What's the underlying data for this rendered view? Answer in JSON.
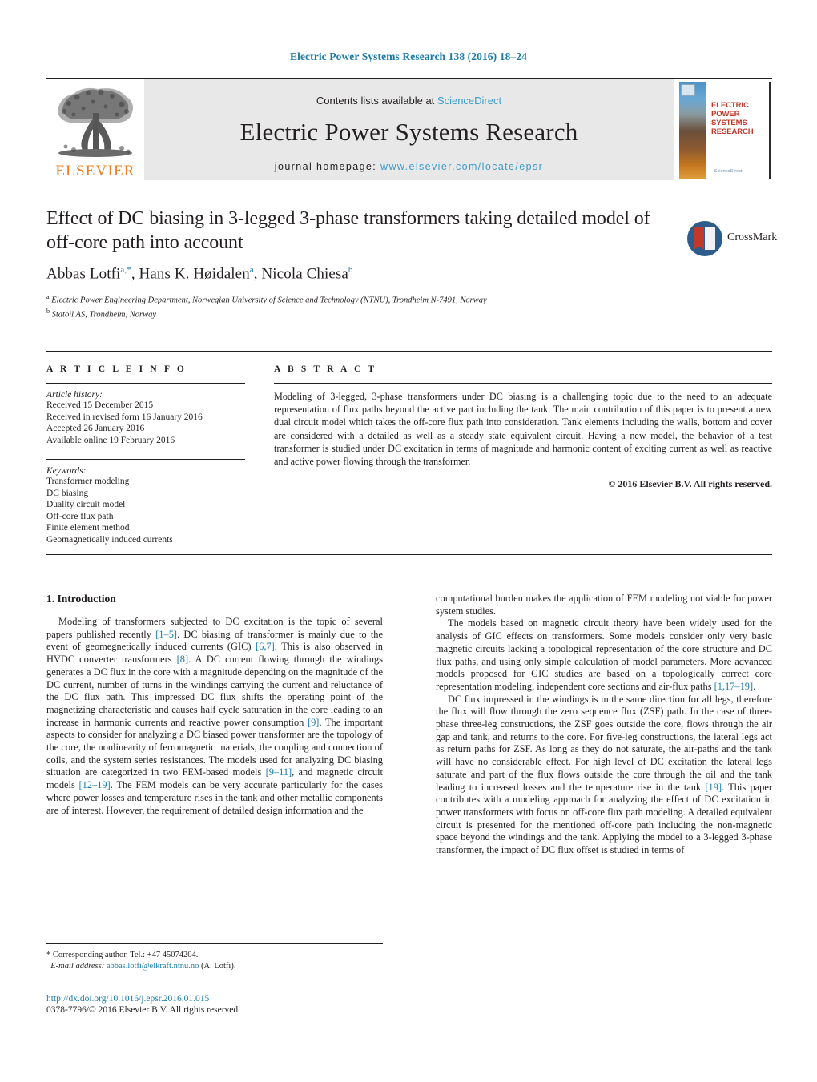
{
  "running_head": "Electric Power Systems Research 138 (2016) 18–24",
  "masthead": {
    "publisher_name": "ELSEVIER",
    "contents_prefix": "Contents lists available at ",
    "contents_link": "ScienceDirect",
    "journal_name": "Electric Power Systems Research",
    "homepage_prefix": "journal homepage: ",
    "homepage_url": "www.elsevier.com/locate/epsr",
    "cover_title": "ELECTRIC POWER SYSTEMS RESEARCH",
    "cover_footer": "ScienceDirect"
  },
  "article": {
    "title": "Effect of DC biasing in 3-legged 3-phase transformers taking detailed model of off-core path into account",
    "crossmark_label": "CrossMark",
    "authors": [
      {
        "name": "Abbas Lotfi",
        "marks": "a,*"
      },
      {
        "name": "Hans K. Høidalen",
        "marks": "a"
      },
      {
        "name": "Nicola Chiesa",
        "marks": "b"
      }
    ],
    "affiliations": [
      {
        "mark": "a",
        "text": "Electric Power Engineering Department, Norwegian University of Science and Technology (NTNU), Trondheim N-7491, Norway"
      },
      {
        "mark": "b",
        "text": "Statoil AS, Trondheim, Norway"
      }
    ]
  },
  "article_info": {
    "heading": "A R T I C L E   I N F O",
    "history_label": "Article history:",
    "history": [
      "Received 15 December 2015",
      "Received in revised form 16 January 2016",
      "Accepted 26 January 2016",
      "Available online 19 February 2016"
    ],
    "keywords_label": "Keywords:",
    "keywords": [
      "Transformer modeling",
      "DC biasing",
      "Duality circuit model",
      "Off-core flux path",
      "Finite element method",
      "Geomagnetically induced currents"
    ]
  },
  "abstract": {
    "heading": "A B S T R A C T",
    "text": "Modeling of 3-legged, 3-phase transformers under DC biasing is a challenging topic due to the need to an adequate representation of flux paths beyond the active part including the tank. The main contribution of this paper is to present a new dual circuit model which takes the off-core flux path into consideration. Tank elements including the walls, bottom and cover are considered with a detailed as well as a steady state equivalent circuit. Having a new model, the behavior of a test transformer is studied under DC excitation in terms of magnitude and harmonic content of exciting current as well as reactive and active power flowing through the transformer.",
    "copyright": "© 2016 Elsevier B.V. All rights reserved."
  },
  "introduction": {
    "heading": "1.  Introduction",
    "left_paragraphs": [
      {
        "segments": [
          {
            "t": "Modeling of transformers subjected to DC excitation is the topic of several papers published recently "
          },
          {
            "t": "[1–5]",
            "ref": true
          },
          {
            "t": ". DC biasing of transformer is mainly due to the event of geomegnetically induced currents (GIC) "
          },
          {
            "t": "[6,7]",
            "ref": true
          },
          {
            "t": ". This is also observed in HVDC converter transformers "
          },
          {
            "t": "[8]",
            "ref": true
          },
          {
            "t": ". A DC current flowing through the windings generates a DC flux in the core with a magnitude depending on the magnitude of the DC current, number of turns in the windings carrying the current and reluctance of the DC flux path. This impressed DC flux shifts the operating point of the magnetizing characteristic and causes half cycle saturation in the core leading to an increase in harmonic currents and reactive power consumption "
          },
          {
            "t": "[9]",
            "ref": true
          },
          {
            "t": ". The important aspects to consider for analyzing a DC biased power transformer are the topology of the core, the nonlinearity of ferromagnetic materials, the coupling and connection of coils, and the system series resistances. The models used for analyzing DC biasing situation are categorized in two FEM-based models "
          },
          {
            "t": "[9–11]",
            "ref": true
          },
          {
            "t": ", and magnetic circuit models "
          },
          {
            "t": "[12–19]",
            "ref": true
          },
          {
            "t": ". The FEM models can be very accurate particularly for the cases where power losses and temperature rises in the tank and other metallic components are of interest. However, the requirement of detailed design information and the"
          }
        ]
      }
    ],
    "right_paragraphs": [
      {
        "no_indent": true,
        "segments": [
          {
            "t": "computational burden makes the application of FEM modeling not viable for power system studies."
          }
        ]
      },
      {
        "segments": [
          {
            "t": "The models based on magnetic circuit theory have been widely used for the analysis of GIC effects on transformers. Some models consider only very basic magnetic circuits lacking a topological representation of the core structure and DC flux paths, and using only simple calculation of model parameters. More advanced models proposed for GIC studies are based on a topologically correct core representation modeling, independent core sections and air-flux paths "
          },
          {
            "t": "[1,17–19]",
            "ref": true
          },
          {
            "t": "."
          }
        ]
      },
      {
        "segments": [
          {
            "t": "DC flux impressed in the windings is in the same direction for all legs, therefore the flux will flow through the zero sequence flux (ZSF) path. In the case of three-phase three-leg constructions, the ZSF goes outside the core, flows through the air gap and tank, and returns to the core. For five-leg constructions, the lateral legs act as return paths for ZSF. As long as they do not saturate, the air-paths and the tank will have no considerable effect. For high level of DC excitation the lateral legs saturate and part of the flux flows outside the core through the oil and the tank leading to increased losses and the temperature rise in the tank "
          },
          {
            "t": "[19]",
            "ref": true
          },
          {
            "t": ". This paper contributes with a modeling approach for analyzing the effect of DC excitation in power transformers with focus on off-core flux path modeling. A detailed equivalent circuit is presented for the mentioned off-core path including the non-magnetic space beyond the windings and the tank. Applying the model to a 3-legged 3-phase transformer, the impact of DC flux offset is studied in terms of"
          }
        ]
      }
    ]
  },
  "footnote": {
    "corresponding": "*  Corresponding author. Tel.: +47 45074204.",
    "email_label": "E-mail address:",
    "email": "abbas.lotfi@elkraft.ntnu.no",
    "email_suffix": " (A. Lotfi)."
  },
  "doi": {
    "url": "http://dx.doi.org/10.1016/j.epsr.2016.01.015",
    "issn_line": "0378-7796/© 2016 Elsevier B.V. All rights reserved."
  },
  "colors": {
    "link_blue": "#1b7ba8",
    "sd_blue": "#3a9ccc",
    "elsevier_orange": "#ef7d20",
    "cover_red": "#c0392b",
    "banner_gray": "#e8e8e8"
  }
}
